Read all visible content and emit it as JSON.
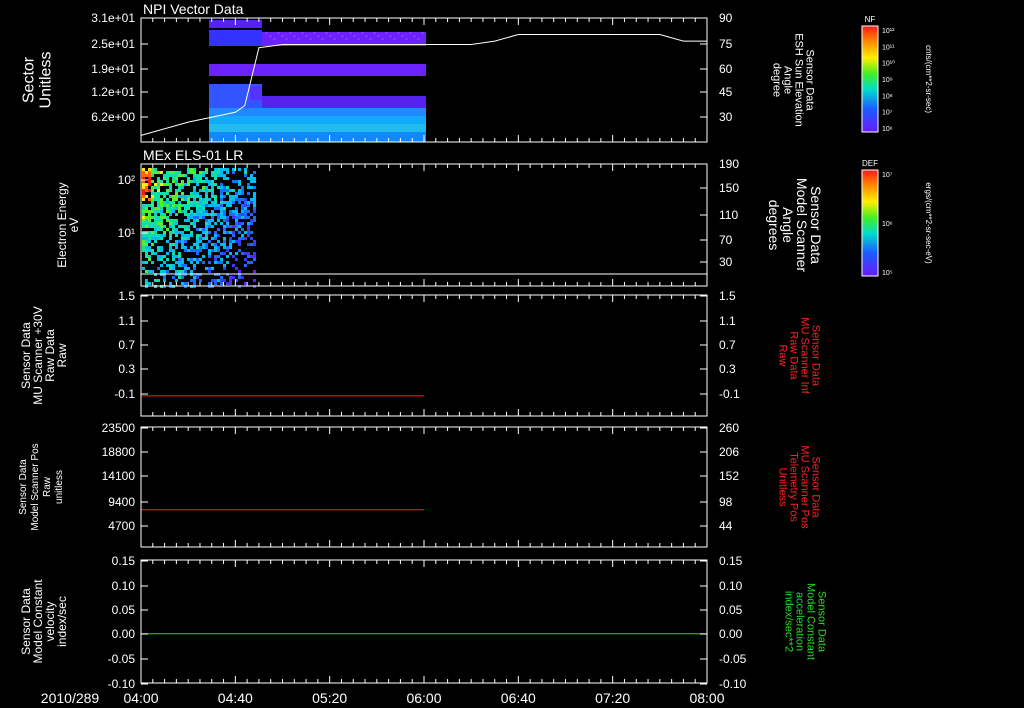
{
  "colors": {
    "background": "#000000",
    "axis": "#ffffff",
    "red_trace": "#ff2020",
    "green_trace": "#22dd22",
    "label_red": "#ff2020",
    "label_green": "#22dd22"
  },
  "time_axis": {
    "date_label": "2010/289",
    "ticks": [
      "04:00",
      "04:40",
      "05:20",
      "06:00",
      "06:40",
      "07:20",
      "08:00"
    ]
  },
  "chart_data": [
    {
      "type": "heatmap",
      "title": "NPI Vector Data",
      "ylabel": [
        "Sector",
        "Unitless"
      ],
      "yticks": [
        "3.1e+01",
        "2.5e+01",
        "1.9e+01",
        "1.2e+01",
        "6.2e+00"
      ],
      "y2label": [
        "Sensor Data",
        "ESH Sun Elevation",
        "Angle",
        "degree"
      ],
      "y2ticks": [
        "90",
        "75",
        "60",
        "45",
        "30"
      ],
      "y2lim": [
        15,
        90
      ],
      "colorbar": {
        "label": "NF",
        "units": "cnts/(cm**2-sr-sec)",
        "ticks": [
          "10¹²",
          "10¹¹",
          "10¹⁰",
          "10⁹",
          "10⁸",
          "10⁷",
          "10⁶"
        ]
      },
      "line": {
        "name": "ESH Sun Elevation",
        "x": [
          "04:00",
          "04:20",
          "04:40",
          "04:44",
          "04:50",
          "05:00",
          "05:40",
          "06:00",
          "06:20",
          "06:30",
          "06:40",
          "07:00",
          "07:20",
          "07:40",
          "07:50",
          "08:00"
        ],
        "y": [
          19,
          27,
          33,
          37,
          72,
          74,
          74,
          74,
          74,
          76,
          80,
          80,
          80,
          80,
          76,
          76
        ]
      }
    },
    {
      "type": "heatmap",
      "title": "MEx ELS-01 LR",
      "ylabel": [
        "Electron Energy",
        "eV"
      ],
      "yticks": [
        "10²",
        "10¹"
      ],
      "y2label": [
        "Sensor Data",
        "Model Scanner",
        "Angle",
        "degrees"
      ],
      "y2ticks": [
        "190",
        "150",
        "110",
        "70",
        "30"
      ],
      "y2lim": [
        10,
        190
      ],
      "colorbar": {
        "label": "DEF",
        "units": "ergs/(cm**2-sr-sec-eV)",
        "ticks": [
          "10⁷",
          "10⁶",
          "10⁵"
        ]
      },
      "line": {
        "name": "Model Scanner Angle",
        "x": [
          "04:00",
          "08:00"
        ],
        "y": [
          10,
          10
        ]
      }
    },
    {
      "type": "line",
      "ylabel": [
        "Sensor Data",
        "MU Scanner +30V",
        "Raw Data",
        "Raw"
      ],
      "yticks": [
        "1.5",
        "1.1",
        "0.7",
        "0.3",
        "-0.1"
      ],
      "ylim": [
        -0.3,
        1.5
      ],
      "y2label": [
        "Sensor Data",
        "MU Scanner Inf",
        "Raw Data",
        "Raw"
      ],
      "y2ticks": [
        "1.5",
        "1.1",
        "0.7",
        "0.3",
        "-0.1"
      ],
      "series": [
        {
          "x": [
            "04:00",
            "06:00"
          ],
          "y": [
            0.0,
            0.0
          ]
        }
      ]
    },
    {
      "type": "line",
      "ylabel": [
        "Sensor Data",
        "Model Scanner Pos",
        "Raw",
        "unitless"
      ],
      "yticks": [
        "23500",
        "18800",
        "14100",
        "9400",
        "4700"
      ],
      "ylim": [
        0,
        23500
      ],
      "y2label": [
        "Sensor Data",
        "MU Scanner Pos",
        "Telemetry Pos",
        "Unitless"
      ],
      "y2ticks": [
        "260",
        "206",
        "152",
        "98",
        "44"
      ],
      "series": [
        {
          "x": [
            "04:00",
            "06:00"
          ],
          "y": [
            7300,
            7300
          ]
        }
      ]
    },
    {
      "type": "line",
      "ylabel": [
        "Sensor Data",
        "Model Constant",
        "velocity",
        "index/sec"
      ],
      "yticks": [
        "0.15",
        "0.10",
        "0.05",
        "0.00",
        "-0.05",
        "-0.10"
      ],
      "ylim": [
        -0.1,
        0.15
      ],
      "y2label": [
        "Sensor Data",
        "Model Constant",
        "acceleration",
        "index/sec**2"
      ],
      "y2ticks": [
        "0.15",
        "0.10",
        "0.05",
        "0.00",
        "-0.05",
        "-0.10"
      ],
      "series": [
        {
          "x": [
            "04:00",
            "08:00"
          ],
          "y": [
            0.0,
            0.0
          ]
        }
      ]
    }
  ]
}
